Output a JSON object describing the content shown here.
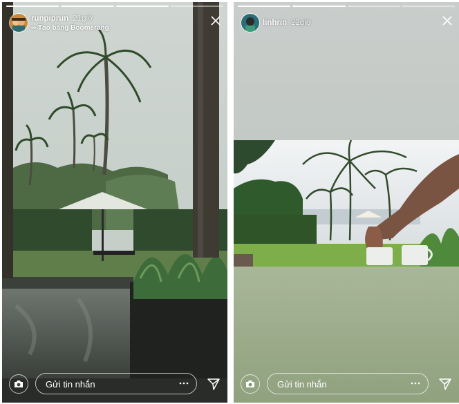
{
  "stories": [
    {
      "username": "runpiprun",
      "time": "21giờ",
      "subtitle": "∞ Tạo bằng Boomerang",
      "message_placeholder": "Gửi tin nhắn",
      "avatar_icon": "user-avatar-icon",
      "progress": {
        "total": 4,
        "done": 3
      }
    },
    {
      "username": "linhrin",
      "time": "22giờ",
      "message_placeholder": "Gửi tin nhắn",
      "avatar_icon": "user-avatar-icon",
      "progress": {
        "total": 4,
        "done": 2
      }
    }
  ],
  "icons": {
    "close": "close-icon",
    "camera": "camera-icon",
    "more": "more-options-icon",
    "send": "send-icon"
  }
}
